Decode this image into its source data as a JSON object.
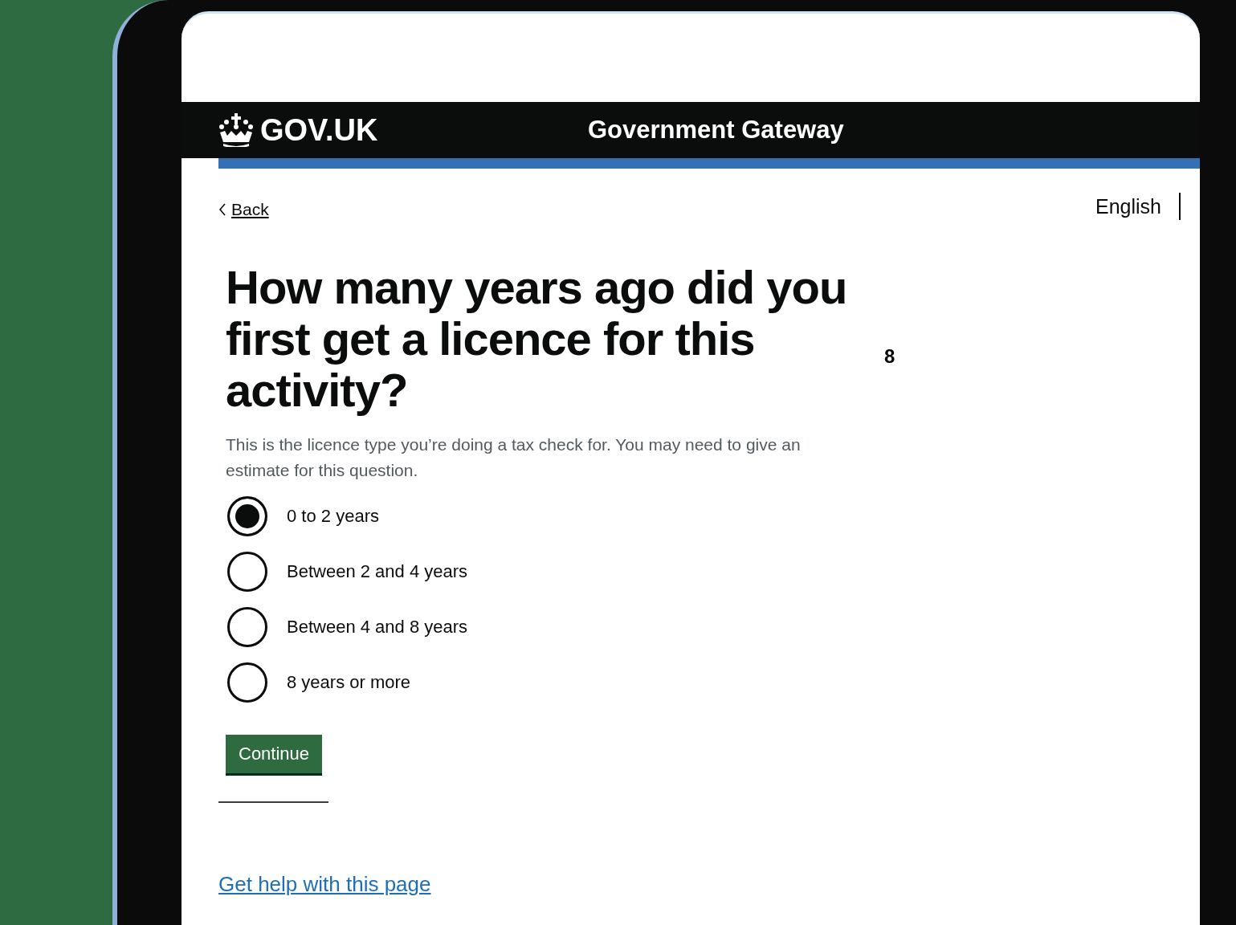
{
  "header": {
    "logo": "GOV.UK",
    "service": "Government Gateway"
  },
  "back_link": "Back",
  "language": "English",
  "question": "How many years ago did you first get a licence for this activity?",
  "fragment": "8",
  "hint": "This is the licence type you’re doing a tax check for. You may need to give an estimate for this question.",
  "options": [
    {
      "label": "0 to 2 years",
      "selected": true
    },
    {
      "label": "Between 2 and 4 years",
      "selected": false
    },
    {
      "label": "Between 4 and 8 years",
      "selected": false
    },
    {
      "label": "8 years or more",
      "selected": false
    }
  ],
  "button": "Continue",
  "help_link": "Get help with this page"
}
